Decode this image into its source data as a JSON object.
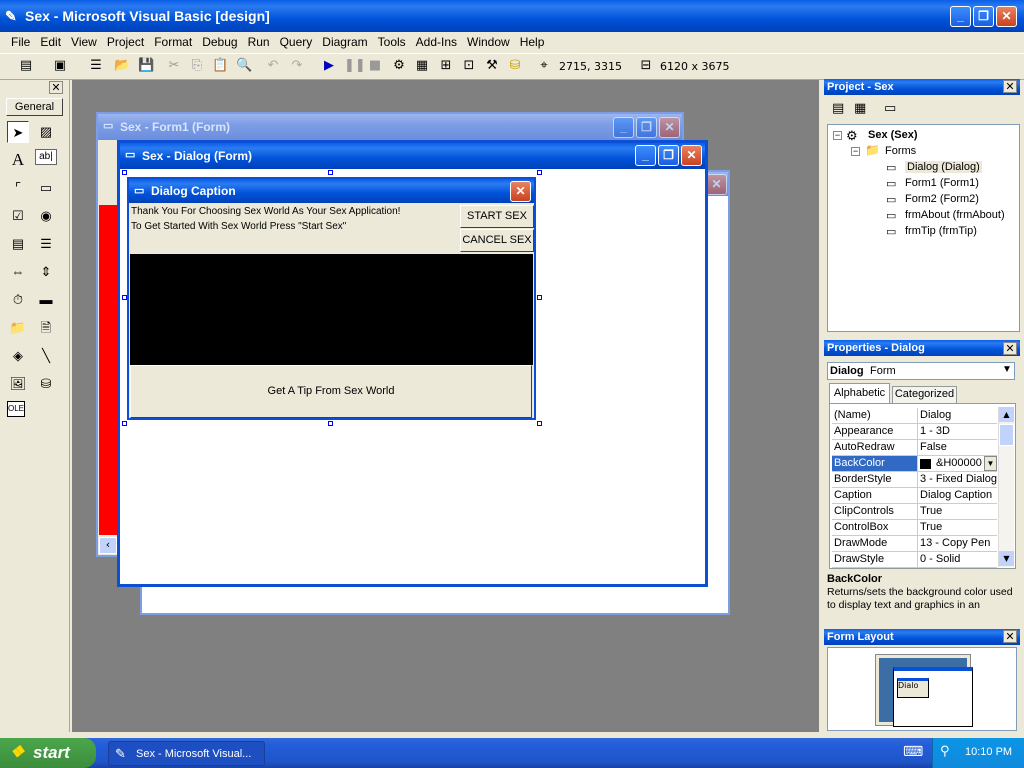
{
  "window": {
    "title": "Sex - Microsoft Visual Basic [design]"
  },
  "menu": [
    "File",
    "Edit",
    "View",
    "Project",
    "Format",
    "Debug",
    "Run",
    "Query",
    "Diagram",
    "Tools",
    "Add-Ins",
    "Window",
    "Help"
  ],
  "toolbar": {
    "position": "2715, 3315",
    "size": "6120 x 3675"
  },
  "toolbox": {
    "tab": "General",
    "items": [
      "pointer-icon",
      "picturebox-icon",
      "label-icon",
      "textbox-icon",
      "frame-icon",
      "commandbutton-icon",
      "checkbox-icon",
      "optionbutton-icon",
      "combobox-icon",
      "listbox-icon",
      "hscrollbar-icon",
      "vscrollbar-icon",
      "timer-icon",
      "drivelistbox-icon",
      "dirlistbox-icon",
      "filelistbox-icon",
      "shape-icon",
      "line-icon",
      "image-icon",
      "data-icon",
      "ole-icon"
    ]
  },
  "form1": {
    "title": "Sex - Form1 (Form)"
  },
  "dialog_form": {
    "title": "Sex - Dialog (Form)"
  },
  "dialog": {
    "caption": "Dialog Caption",
    "line1": "Thank You For Choosing Sex World As Your Sex Application!",
    "line2": "To Get Started With Sex World Press \"Start Sex\"",
    "start": "START SEX",
    "cancel": "CANCEL SEX",
    "tip": "Get A Tip From Sex World"
  },
  "project": {
    "title": "Project - Sex",
    "root": "Sex (Sex)",
    "folder": "Forms",
    "items": [
      "Dialog (Dialog)",
      "Form1 (Form1)",
      "Form2 (Form2)",
      "frmAbout (frmAbout)",
      "frmTip (frmTip)"
    ]
  },
  "properties": {
    "title": "Properties - Dialog",
    "object": "Dialog",
    "object_type": "Form",
    "tab_alpha": "Alphabetic",
    "tab_cat": "Categorized",
    "rows": [
      {
        "name": "(Name)",
        "value": "Dialog"
      },
      {
        "name": "Appearance",
        "value": "1 - 3D"
      },
      {
        "name": "AutoRedraw",
        "value": "False"
      },
      {
        "name": "BackColor",
        "value": "&H00000"
      },
      {
        "name": "BorderStyle",
        "value": "3 - Fixed Dialog"
      },
      {
        "name": "Caption",
        "value": "Dialog Caption"
      },
      {
        "name": "ClipControls",
        "value": "True"
      },
      {
        "name": "ControlBox",
        "value": "True"
      },
      {
        "name": "DrawMode",
        "value": "13 - Copy Pen"
      },
      {
        "name": "DrawStyle",
        "value": "0 - Solid"
      }
    ],
    "desc_title": "BackColor",
    "desc_text": "Returns/sets the background color used to display text and graphics in an"
  },
  "layout": {
    "title": "Form Layout",
    "label": "Dialo"
  },
  "taskbar": {
    "start": "start",
    "task": "Sex - Microsoft Visual...",
    "clock": "10:10 PM"
  }
}
